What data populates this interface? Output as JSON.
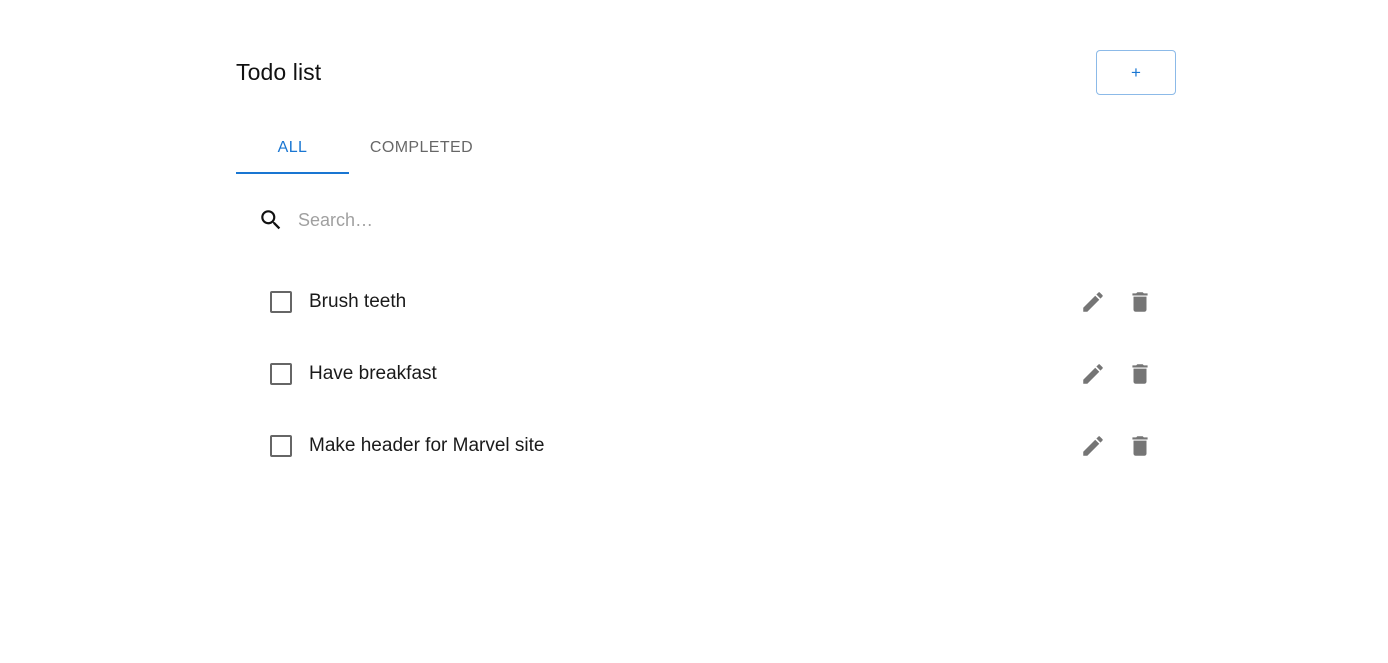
{
  "header": {
    "title": "Todo list",
    "add_button_label": "+"
  },
  "tabs": [
    {
      "label": "ALL",
      "active": true
    },
    {
      "label": "COMPLETED",
      "active": false
    }
  ],
  "search": {
    "placeholder": "Search…",
    "value": "",
    "icon": "search-icon"
  },
  "todos": [
    {
      "text": "Brush teeth",
      "completed": false
    },
    {
      "text": "Have breakfast",
      "completed": false
    },
    {
      "text": "Make header for Marvel site",
      "completed": false
    }
  ],
  "icons": {
    "edit": "pencil-icon",
    "delete": "trash-icon"
  },
  "colors": {
    "accent": "#1976d2",
    "icon_gray": "#757575",
    "tab_inactive": "#666666"
  }
}
